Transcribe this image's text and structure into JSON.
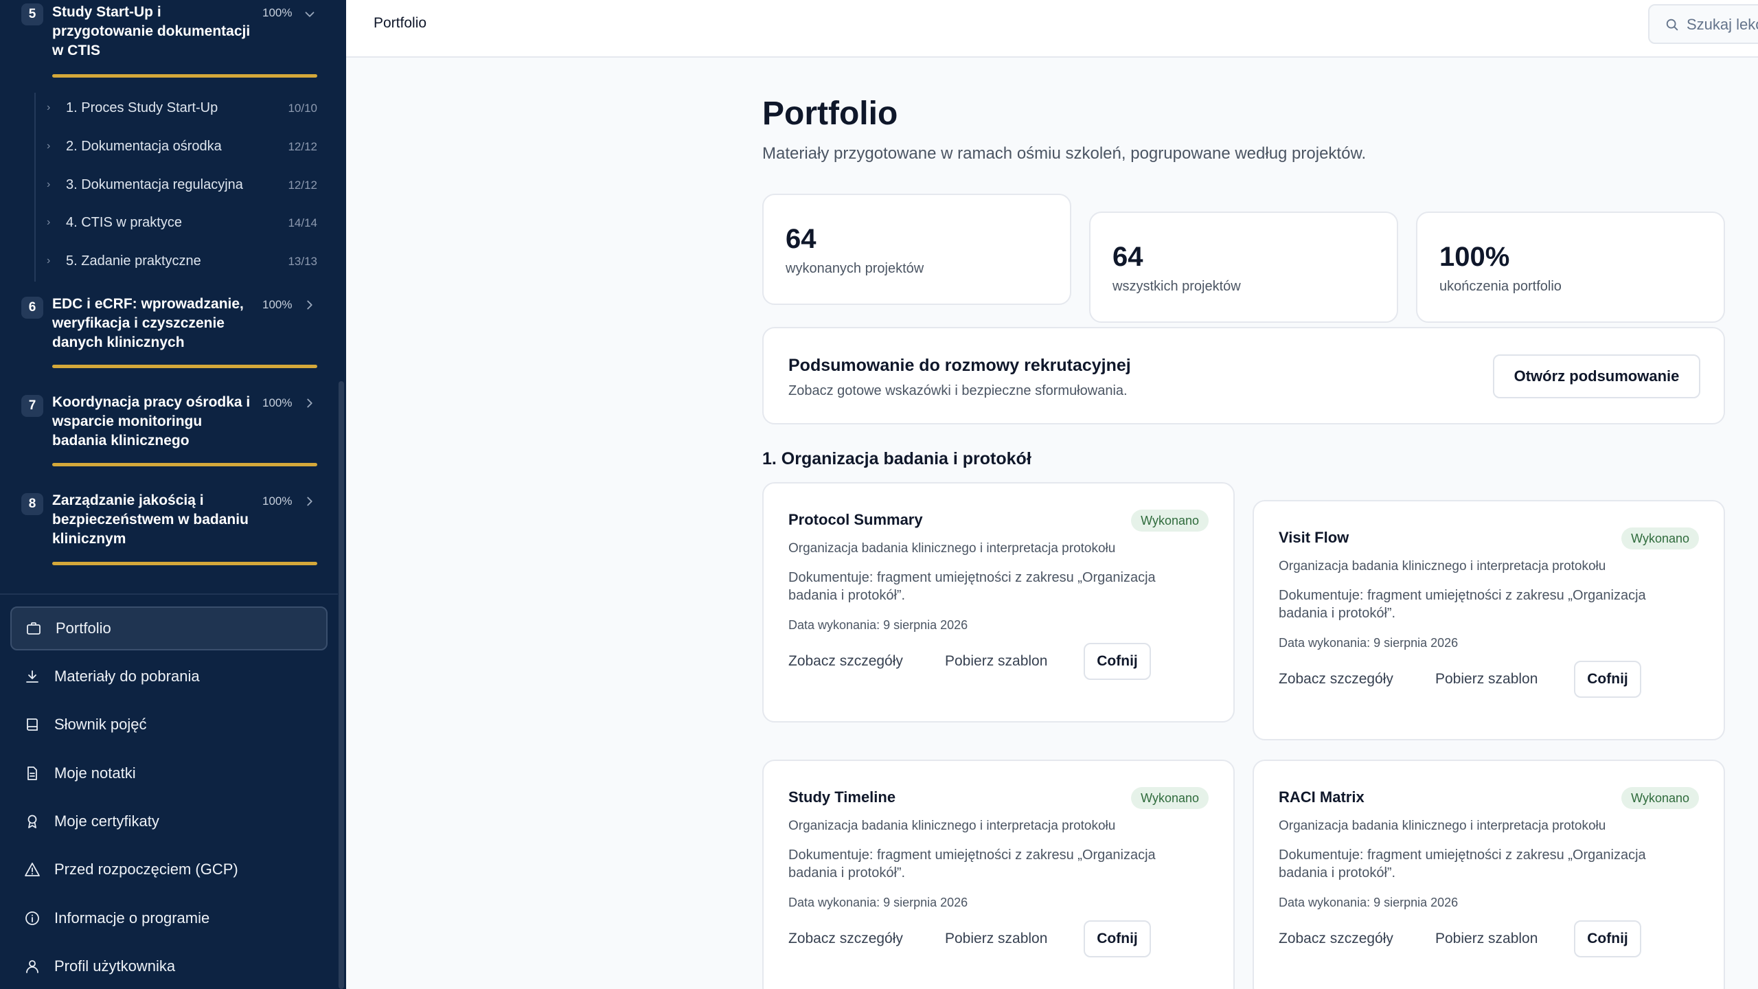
{
  "sidebar": {
    "modules": [
      {
        "num": "5",
        "title": "Study Start-Up i przygotowanie dokumentacji w CTIS",
        "pct": "100%"
      },
      {
        "num": "6",
        "title": "EDC i eCRF: wprowadzanie, weryfikacja i czyszczenie danych klinicznych",
        "pct": "100%"
      },
      {
        "num": "7",
        "title": "Koordynacja pracy ośrodka i wsparcie monitoringu badania klinicznego",
        "pct": "100%"
      },
      {
        "num": "8",
        "title": "Zarządzanie jakością i bezpieczeństwem w badaniu klinicznym",
        "pct": "100%"
      }
    ],
    "lessons": [
      {
        "label": "1. Proces Study Start-Up",
        "count": "10/10"
      },
      {
        "label": "2. Dokumentacja ośrodka",
        "count": "12/12"
      },
      {
        "label": "3. Dokumentacja regulacyjna",
        "count": "12/12"
      },
      {
        "label": "4. CTIS w praktyce",
        "count": "14/14"
      },
      {
        "label": "5. Zadanie praktyczne",
        "count": "13/13"
      }
    ],
    "nav": [
      {
        "label": "Portfolio",
        "icon": "briefcase-icon"
      },
      {
        "label": "Materiały do pobrania",
        "icon": "download-icon"
      },
      {
        "label": "Słownik pojęć",
        "icon": "book-icon"
      },
      {
        "label": "Moje notatki",
        "icon": "notes-icon"
      },
      {
        "label": "Moje certyfikaty",
        "icon": "award-icon"
      },
      {
        "label": "Przed rozpoczęciem (GCP)",
        "icon": "warning-icon"
      },
      {
        "label": "Informacje o programie",
        "icon": "info-icon"
      },
      {
        "label": "Profil użytkownika",
        "icon": "user-icon"
      }
    ]
  },
  "header": {
    "breadcrumb": "Portfolio",
    "search_placeholder": "Szukaj lekcji"
  },
  "main": {
    "title": "Portfolio",
    "subtitle": "Materiały przygotowane w ramach ośmiu szkoleń, pogrupowane według projektów.",
    "stats": [
      {
        "value": "64",
        "label": "wykonanych projektów"
      },
      {
        "value": "64",
        "label": "wszystkich projektów"
      },
      {
        "value": "100%",
        "label": "ukończenia portfolio"
      }
    ],
    "summary": {
      "title": "Podsumowanie do rozmowy rekrutacyjnej",
      "subtitle": "Zobacz gotowe wskazówki i bezpieczne sformułowania.",
      "button": "Otwórz podsumowanie"
    },
    "section_title": "1. Organizacja badania i protokół",
    "cards": [
      {
        "title": "Protocol Summary",
        "badge": "Wykonano",
        "org": "Organizacja badania klinicznego i interpretacja protokołu",
        "doc": "Dokumentuje: fragment umiejętności z zakresu „Organizacja badania i protokół”.",
        "date": "Data wykonania: 9 sierpnia 2026",
        "details": "Zobacz szczegóły",
        "template": "Pobierz szablon",
        "undo": "Cofnij"
      },
      {
        "title": "Visit Flow",
        "badge": "Wykonano",
        "org": "Organizacja badania klinicznego i interpretacja protokołu",
        "doc": "Dokumentuje: fragment umiejętności z zakresu „Organizacja badania i protokół”.",
        "date": "Data wykonania: 9 sierpnia 2026",
        "details": "Zobacz szczegóły",
        "template": "Pobierz szablon",
        "undo": "Cofnij"
      },
      {
        "title": "Study Timeline",
        "badge": "Wykonano",
        "org": "Organizacja badania klinicznego i interpretacja protokołu",
        "doc": "Dokumentuje: fragment umiejętności z zakresu „Organizacja badania i protokół”.",
        "date": "Data wykonania: 9 sierpnia 2026",
        "details": "Zobacz szczegóły",
        "template": "Pobierz szablon",
        "undo": "Cofnij"
      },
      {
        "title": "RACI Matrix",
        "badge": "Wykonano",
        "org": "Organizacja badania klinicznego i interpretacja protokołu",
        "doc": "Dokumentuje: fragment umiejętności z zakresu „Organizacja badania i protokół”.",
        "date": "Data wykonania: 9 sierpnia 2026",
        "details": "Zobacz szczegóły",
        "template": "Pobierz szablon",
        "undo": "Cofnij"
      }
    ]
  },
  "colors": {
    "sidebar_bg": "#0d2342",
    "accent_gold": "#d4a83a",
    "badge_bg": "#e6f2e9",
    "badge_text": "#2f6b3c"
  }
}
